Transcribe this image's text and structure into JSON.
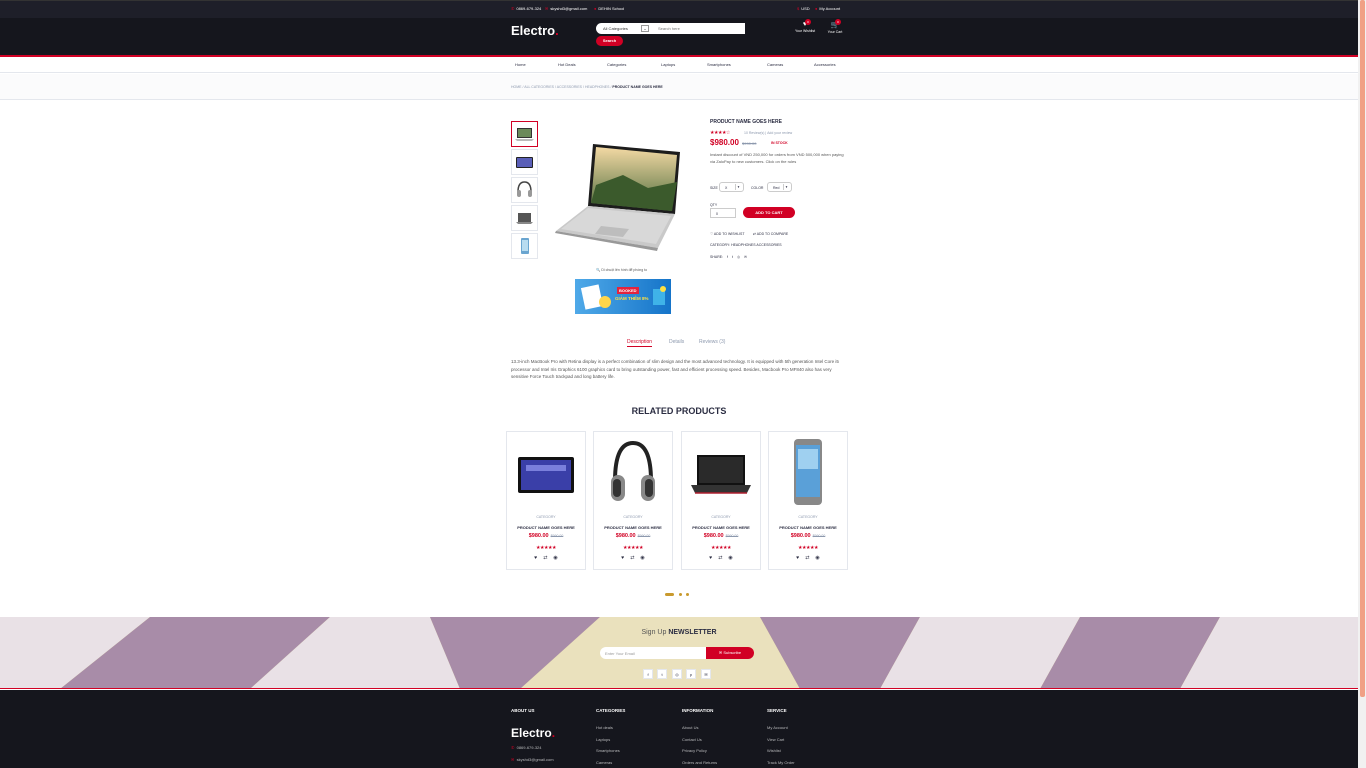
{
  "top_header": {
    "phone": "0869-679-324",
    "email": "skyshd3@gmail.com",
    "address": "DEHIN School",
    "currency": "USD",
    "account": "My Account"
  },
  "header": {
    "logo": "Electro",
    "logo_dot": ".",
    "category_select": "All Categories",
    "search_placeholder": "Search here",
    "search_button": "Search",
    "wishlist": {
      "label": "Your Wishlist",
      "qty": "0"
    },
    "cart": {
      "label": "Your Cart",
      "qty": "0"
    }
  },
  "nav": [
    "Home",
    "Hot Deals",
    "Categories",
    "Laptops",
    "Smartphones",
    "Cameras",
    "Accessories"
  ],
  "breadcrumb": {
    "items": [
      "HOME",
      "ALL CATEGORIES",
      "ACCESSORIES",
      "HEADPHONES"
    ],
    "current": "PRODUCT NAME GOES HERE"
  },
  "product": {
    "name": "PRODUCT NAME GOES HERE",
    "rating": "★★★★☆",
    "review_link": "10 Review(s) | Add your review",
    "price": "$980.00",
    "old_price": "$990.00",
    "stock": "IN STOCK",
    "short_desc": "Instant discount of VND 250,000 for orders from VND 500,000 when paying via ZaloPay to new customers. Click on the rules",
    "size_label": "SIZE",
    "size_value": "X",
    "color_label": "COLOR",
    "color_value": "Red",
    "qty_label": "QTY",
    "qty_value": "0",
    "add_to_cart": "ADD TO CART",
    "add_wishlist": "♡ ADD TO WISHLIST",
    "add_compare": "⇄ ADD TO COMPARE",
    "category_line": "CATEGORY:  HEADPHONES  ACCESSORIES",
    "share_label": "SHARE:",
    "zoom_hint": "🔍 Di chuột lên hình để phóng to",
    "promo_t1": "BOOKED",
    "promo_t2": "GIẢM THÊM 8%"
  },
  "tabs": [
    "Description",
    "Details",
    "Reviews (3)"
  ],
  "description": "13.3-inch MacBook Pro with Retina display is a perfect combination of slim design and the most advanced technology. It is equipped with 5th generation Intel Core i5 processor and Intel Iris Graphics 6100 graphics card to bring outstanding power, fast and efficient processing speed. Besides, Macbook Pro MF840 also has very sensitive Force Touch trackpad and long battery life.",
  "related": {
    "title": "RELATED PRODUCTS",
    "items": [
      {
        "category": "CATEGORY",
        "name": "PRODUCT NAME GOES HERE",
        "price": "$980.00",
        "old": "$990.00",
        "stars": "★★★★★"
      },
      {
        "category": "CATEGORY",
        "name": "PRODUCT NAME GOES HERE",
        "price": "$980.00",
        "old": "$990.00",
        "stars": "★★★★★"
      },
      {
        "category": "CATEGORY",
        "name": "PRODUCT NAME GOES HERE",
        "price": "$980.00",
        "old": "$990.00",
        "stars": "★★★★★"
      },
      {
        "category": "CATEGORY",
        "name": "PRODUCT NAME GOES HERE",
        "price": "$980.00",
        "old": "$990.00",
        "stars": "★★★★★"
      }
    ]
  },
  "newsletter": {
    "title_pre": "Sign Up",
    "title_bold": "NEWSLETTER",
    "placeholder": "Enter Your Email",
    "button": "✉ Subscribe"
  },
  "footer": {
    "about": {
      "title": "ABOUT US",
      "phone": "0869-679-324",
      "email": "skyshd3@gmail.com"
    },
    "categories": {
      "title": "CATEGORIES",
      "links": [
        "Hot deals",
        "Laptops",
        "Smartphones",
        "Cameras"
      ]
    },
    "information": {
      "title": "INFORMATION",
      "links": [
        "About Us",
        "Contact Us",
        "Privacy Policy",
        "Orders and Returns"
      ]
    },
    "service": {
      "title": "SERVICE",
      "links": [
        "My Account",
        "View Cart",
        "Wishlist",
        "Track My Order"
      ]
    }
  },
  "colors": {
    "accent": "#d10024",
    "dark": "#15161d",
    "newsletter_bg": "#ebe080"
  }
}
